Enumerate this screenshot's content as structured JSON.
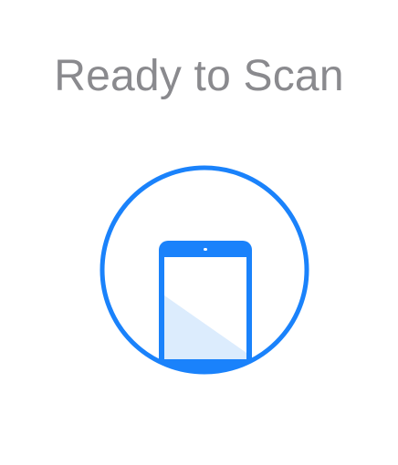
{
  "title": "Ready to Scan",
  "illustration": {
    "icon": "phone-nfc-scan-icon",
    "accent_color": "#1a82fb",
    "screen_tint": "#dcecfd"
  }
}
